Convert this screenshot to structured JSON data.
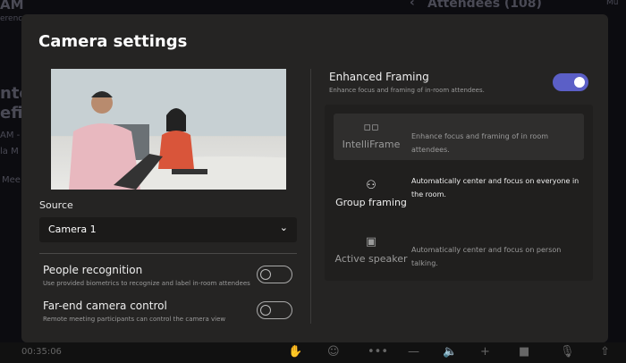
{
  "background": {
    "fragments": [
      "AM",
      "erenc",
      "nto",
      "efi",
      "AM -",
      "la M",
      "Mee"
    ],
    "attendees": "Attendees (108)",
    "right_fragment": "Mu",
    "back_icon": "chevron-left-icon"
  },
  "dialog": {
    "title": "Camera settings",
    "source": {
      "label": "Source",
      "value": "Camera 1"
    },
    "people_recognition": {
      "title": "People recognition",
      "subtitle": "Use provided biometrics to recognize and label in-room attendees",
      "enabled": false
    },
    "far_end": {
      "title": "Far-end camera control",
      "subtitle": "Remote meeting participants can control the camera view",
      "enabled": false
    },
    "enhanced_framing": {
      "title": "Enhanced Framing",
      "subtitle": "Enhance focus and framing of in-room attendees.",
      "enabled": true,
      "accent": "#5b5fc7"
    },
    "modes": [
      {
        "name": "IntelliFrame",
        "icon": "grid-icon",
        "description": "Enhance focus and framing of in room attendees.",
        "selected": true
      },
      {
        "name": "Group framing",
        "icon": "group-icon",
        "description": "Automatically center and focus on everyone in the room.",
        "selected": false
      },
      {
        "name": "Active speaker",
        "icon": "person-frame-icon",
        "description": "Automatically center and focus on person talking.",
        "selected": false
      }
    ]
  },
  "call_bar": {
    "timer": "00:35:06"
  }
}
